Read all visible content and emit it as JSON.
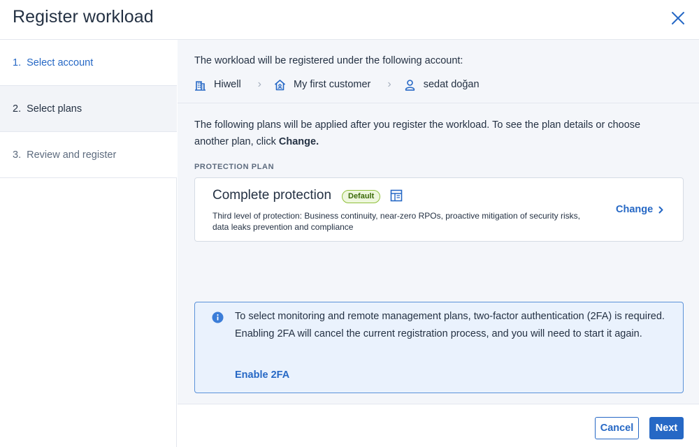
{
  "dialog": {
    "title": "Register workload",
    "close_icon": "close-icon"
  },
  "steps": [
    {
      "num": "1.",
      "label": "Select account",
      "state": "completed"
    },
    {
      "num": "2.",
      "label": "Select plans",
      "state": "active"
    },
    {
      "num": "3.",
      "label": "Review and register",
      "state": "pending"
    }
  ],
  "account": {
    "intro": "The workload will be registered under the following account:",
    "breadcrumb": [
      {
        "icon": "building-icon",
        "label": "Hiwell"
      },
      {
        "icon": "customer-home-icon",
        "label": "My first customer"
      },
      {
        "icon": "user-icon",
        "label": "sedat doğan"
      }
    ],
    "separator": "›"
  },
  "plans": {
    "text_before": "The following plans will be applied after you register the workload. To see the plan details or choose another plan, click ",
    "text_bold": "Change.",
    "section_label": "PROTECTION PLAN",
    "plan_name": "Complete protection",
    "badge": "Default",
    "plan_icon": "plan-details-icon",
    "plan_description": "Third level of protection: Business continuity, near-zero RPOs, proactive mitigation of security risks, data leaks prevention and compliance",
    "change_label": "Change"
  },
  "info": {
    "icon": "info-icon",
    "text": "To select monitoring and remote management plans, two-factor authentication (2FA) is required. Enabling 2FA will cancel the current registration process, and you will need to start it again.",
    "link": "Enable 2FA"
  },
  "footer": {
    "cancel_label": "Cancel",
    "next_label": "Next"
  },
  "colors": {
    "accent": "#2668c5",
    "text": "#243143",
    "badge_border": "#8fbf3b",
    "info_bg": "#eaf2fd"
  }
}
